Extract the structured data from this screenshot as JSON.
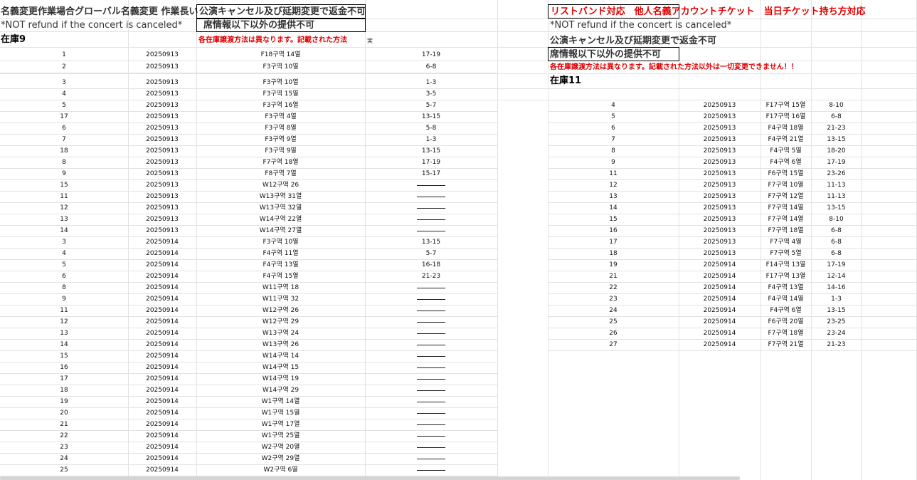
{
  "left": {
    "header1": "名義変更作業場合グローバル名義変更 作業長い",
    "header2": "公演キャンセル及び延期変更で返金不可",
    "refund_en": "*NOT refund if the concert is canceled*",
    "seat_info": "席情報以下以外の提供不可",
    "stock_title": "在庫9",
    "transfer_note": "各在庫譲渡方法は異なります。記載された方法",
    "transfer_note_tail": "実",
    "rows": [
      {
        "no": "1",
        "date": "20250913",
        "seat": "F18구역 14열",
        "num": "17-19"
      },
      {
        "no": "2",
        "date": "20250913",
        "seat": "F3구역 10열",
        "num": "6-8"
      },
      {
        "no": "3",
        "date": "20250913",
        "seat": "F3구역 10열",
        "num": "1-3"
      },
      {
        "no": "4",
        "date": "20250913",
        "seat": "F3구역 15열",
        "num": "3-5"
      },
      {
        "no": "5",
        "date": "20250913",
        "seat": "F3구역 16열",
        "num": "5-7"
      },
      {
        "no": "17",
        "date": "20250913",
        "seat": "F3구역 4열",
        "num": "13-15"
      },
      {
        "no": "6",
        "date": "20250913",
        "seat": "F3구역 8열",
        "num": "5-8"
      },
      {
        "no": "7",
        "date": "20250913",
        "seat": "F3구역 9열",
        "num": "1-3"
      },
      {
        "no": "18",
        "date": "20250913",
        "seat": "F3구역 9열",
        "num": "13-15"
      },
      {
        "no": "8",
        "date": "20250913",
        "seat": "F7구역 18열",
        "num": "17-19"
      },
      {
        "no": "9",
        "date": "20250913",
        "seat": "F8구역 7열",
        "num": "15-17"
      },
      {
        "no": "15",
        "date": "20250913",
        "seat": "W12구역 26",
        "num": "————"
      },
      {
        "no": "11",
        "date": "20250913",
        "seat": "W13구역 31열",
        "num": "————"
      },
      {
        "no": "12",
        "date": "20250913",
        "seat": "W13구역 32열",
        "num": "————"
      },
      {
        "no": "13",
        "date": "20250913",
        "seat": "W14구역 22열",
        "num": "————"
      },
      {
        "no": "14",
        "date": "20250913",
        "seat": "W14구역 27열",
        "num": "————"
      },
      {
        "no": "3",
        "date": "20250914",
        "seat": "F3구역 10열",
        "num": "13-15"
      },
      {
        "no": "4",
        "date": "20250914",
        "seat": "F4구역 11열",
        "num": "5-7"
      },
      {
        "no": "5",
        "date": "20250914",
        "seat": "F4구역 13열",
        "num": "16-18"
      },
      {
        "no": "6",
        "date": "20250914",
        "seat": "F4구역 15열",
        "num": "21-23"
      },
      {
        "no": "8",
        "date": "20250914",
        "seat": "W11구역 18",
        "num": "————"
      },
      {
        "no": "9",
        "date": "20250914",
        "seat": "W11구역 32",
        "num": "————"
      },
      {
        "no": "11",
        "date": "20250914",
        "seat": "W12구역 26",
        "num": "————"
      },
      {
        "no": "12",
        "date": "20250914",
        "seat": "W12구역 29",
        "num": "————"
      },
      {
        "no": "13",
        "date": "20250914",
        "seat": "W13구역 24",
        "num": "————"
      },
      {
        "no": "14",
        "date": "20250914",
        "seat": "W13구역 26",
        "num": "————"
      },
      {
        "no": "15",
        "date": "20250914",
        "seat": "W14구역 14",
        "num": "————"
      },
      {
        "no": "16",
        "date": "20250914",
        "seat": "W14구역 15",
        "num": "————"
      },
      {
        "no": "17",
        "date": "20250914",
        "seat": "W14구역 19",
        "num": "————"
      },
      {
        "no": "18",
        "date": "20250914",
        "seat": "W14구역 29",
        "num": "————"
      },
      {
        "no": "19",
        "date": "20250914",
        "seat": "W1구역 14열",
        "num": "————"
      },
      {
        "no": "20",
        "date": "20250914",
        "seat": "W1구역 15열",
        "num": "————"
      },
      {
        "no": "21",
        "date": "20250914",
        "seat": "W1구역 17열",
        "num": "————"
      },
      {
        "no": "22",
        "date": "20250914",
        "seat": "W1구역 25열",
        "num": "————"
      },
      {
        "no": "23",
        "date": "20250914",
        "seat": "W2구역 20열",
        "num": "————"
      },
      {
        "no": "24",
        "date": "20250914",
        "seat": "W2구역 29열",
        "num": "————"
      },
      {
        "no": "25",
        "date": "20250914",
        "seat": "W2구역 6열",
        "num": "————"
      }
    ]
  },
  "right": {
    "header_red": "リストバンド対応　他人名義アカウントチケット　当日チケット持ち方対応",
    "refund_en": "*NOT refund if the concert is canceled*",
    "refund_jp": "公演キャンセル及び延期変更で返金不可",
    "seat_info": "席情報以下以外の提供不可",
    "transfer_note": "各在庫譲渡方法は異なります。記載された方法以外は一切変更できません！！",
    "stock_title": "在庫11",
    "rows": [
      {
        "no": "4",
        "date": "20250913",
        "seat": "F17구역 15열",
        "num": "8-10"
      },
      {
        "no": "5",
        "date": "20250913",
        "seat": "F17구역 16열",
        "num": "6-8"
      },
      {
        "no": "6",
        "date": "20250913",
        "seat": "F4구역 18열",
        "num": "21-23"
      },
      {
        "no": "7",
        "date": "20250913",
        "seat": "F4구역 21열",
        "num": "13-15"
      },
      {
        "no": "8",
        "date": "20250913",
        "seat": "F4구역 5열",
        "num": "18-20"
      },
      {
        "no": "9",
        "date": "20250913",
        "seat": "F4구역 6열",
        "num": "17-19"
      },
      {
        "no": "11",
        "date": "20250913",
        "seat": "F6구역 15열",
        "num": "23-26"
      },
      {
        "no": "12",
        "date": "20250913",
        "seat": "F7구역 10열",
        "num": "11-13"
      },
      {
        "no": "13",
        "date": "20250913",
        "seat": "F7구역 12열",
        "num": "11-13"
      },
      {
        "no": "14",
        "date": "20250913",
        "seat": "F7구역 14열",
        "num": "13-15"
      },
      {
        "no": "15",
        "date": "20250913",
        "seat": "F7구역 14열",
        "num": "8-10"
      },
      {
        "no": "16",
        "date": "20250913",
        "seat": "F7구역 18열",
        "num": "6-8"
      },
      {
        "no": "17",
        "date": "20250913",
        "seat": "F7구역 4열",
        "num": "6-8"
      },
      {
        "no": "18",
        "date": "20250913",
        "seat": "F7구역 5열",
        "num": "6-8"
      },
      {
        "no": "19",
        "date": "20250914",
        "seat": "F14구역 13열",
        "num": "17-19"
      },
      {
        "no": "21",
        "date": "20250914",
        "seat": "F17구역 13열",
        "num": "12-14"
      },
      {
        "no": "22",
        "date": "20250914",
        "seat": "F4구역 13열",
        "num": "14-16"
      },
      {
        "no": "23",
        "date": "20250914",
        "seat": "F4구역 14열",
        "num": "1-3"
      },
      {
        "no": "24",
        "date": "20250914",
        "seat": "F4구역 6열",
        "num": "13-15"
      },
      {
        "no": "25",
        "date": "20250914",
        "seat": "F6구역 20열",
        "num": "23-25"
      },
      {
        "no": "26",
        "date": "20250914",
        "seat": "F7구역 18열",
        "num": "23-24"
      },
      {
        "no": "27",
        "date": "20250914",
        "seat": "F7구역 21열",
        "num": "21-23"
      }
    ]
  }
}
